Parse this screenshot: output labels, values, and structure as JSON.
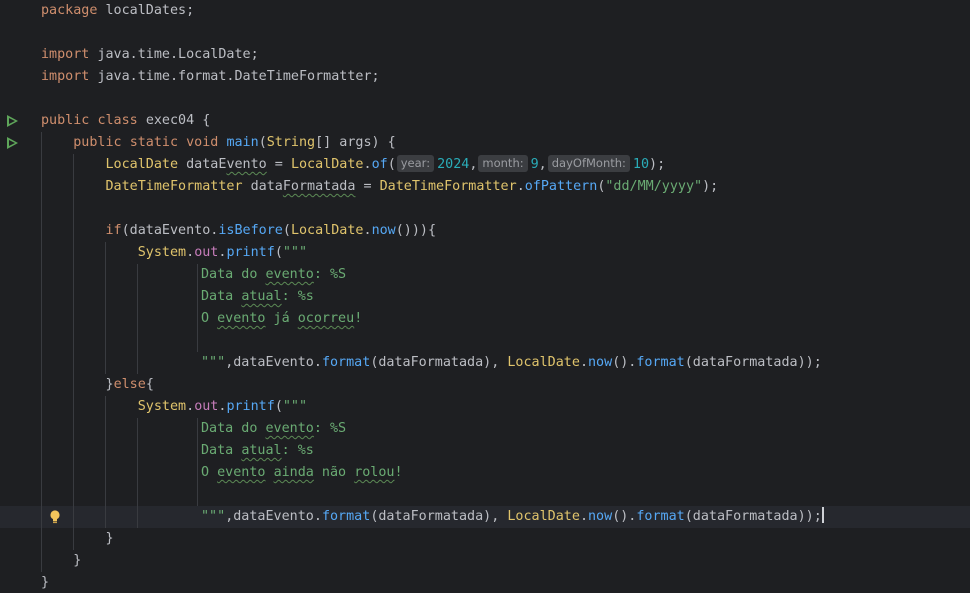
{
  "editor": {
    "language": "Java",
    "colors": {
      "background": "#1e1f22",
      "keyword": "#cf8e6d",
      "class": "#e0c46c",
      "method": "#56a8f5",
      "string": "#6aab73",
      "number": "#2aacb8",
      "field": "#c77dbb"
    },
    "gutter_icons": [
      "run-icon",
      "run-icon",
      "lightbulb-icon"
    ],
    "code": {
      "l1": {
        "kw": "package",
        "name": "localDates;"
      },
      "l3": {
        "kw": "import",
        "path": "java.time.LocalDate;"
      },
      "l4": {
        "kw": "import",
        "path": "java.time.format.DateTimeFormatter;"
      },
      "l6": {
        "kw1": "public",
        "kw2": "class",
        "name": "exec04 {"
      },
      "l7": {
        "kw1": "public",
        "kw2": "static",
        "kw3": "void",
        "method": "main",
        "p1": "(",
        "type": "String",
        "rest": "[] args) {"
      },
      "l8": {
        "type": "LocalDate",
        "var_a": "dataE",
        "var_b": "vento",
        "eq": " = ",
        "cls": "LocalDate",
        "dot": ".",
        "method": "of",
        "open": "(",
        "hint_year": "year:",
        "year": "2024",
        "c1": ",",
        "hint_month": "month:",
        "month": "9",
        "c2": ",",
        "hint_day": "dayOfMonth:",
        "day": "10",
        "close": ");"
      },
      "l9": {
        "type": "DateTimeFormatter",
        "var_a": "data",
        "var_b": "Formatada",
        "eq": " = ",
        "cls": "DateTimeFormatter",
        "dot": ".",
        "method": "ofPattern",
        "open": "(",
        "pattern": "\"dd/MM/yyyy\"",
        "close": ");"
      },
      "l11": {
        "kw": "if",
        "p1": "(dataEvento.",
        "method": "isBefore",
        "p2": "(",
        "cls": "LocalDate",
        "dot": ".",
        "method2": "now",
        "close": "())){"
      },
      "l12": {
        "cls": "System",
        "dot1": ".",
        "field": "out",
        "dot2": ".",
        "method": "printf",
        "open": "(",
        "str": "\"\"\""
      },
      "l13": {
        "a": "Data do ",
        "b": "evento",
        "c": ": %S"
      },
      "l14": {
        "a": "Data ",
        "b": "atual",
        "c": ": %s"
      },
      "l15": {
        "a": "O ",
        "b": "evento",
        "c": " já ",
        "d": "ocorreu",
        "e": "!"
      },
      "l17": {
        "str": "\"\"\"",
        "p1": ",dataEvento.",
        "m1": "format",
        "p2": "(dataFormatada), ",
        "cls": "LocalDate",
        "dot": ".",
        "m2": "now",
        "p3": "().",
        "m3": "format",
        "close": "(dataFormatada));"
      },
      "l18": {
        "p1": "}",
        "kw": "else",
        "p2": "{"
      },
      "l19": {
        "cls": "System",
        "dot1": ".",
        "field": "out",
        "dot2": ".",
        "method": "printf",
        "open": "(",
        "str": "\"\"\""
      },
      "l20": {
        "a": "Data do ",
        "b": "evento",
        "c": ": %S"
      },
      "l21": {
        "a": "Data ",
        "b": "atual",
        "c": ": %s"
      },
      "l22": {
        "a": "O ",
        "b": "evento",
        "c": " ",
        "d": "ainda",
        "e": " não ",
        "f": "rolou",
        "g": "!"
      },
      "l24": {
        "str": "\"\"\"",
        "p1": ",dataEvento.",
        "m1": "format",
        "p2": "(dataFormatada), ",
        "cls": "LocalDate",
        "dot": ".",
        "m2": "now",
        "p3": "().",
        "m3": "format",
        "close": "(dataFormatada));"
      },
      "l25": {
        "brace": "}"
      },
      "l26": {
        "brace": "}"
      },
      "l27": {
        "brace": "}"
      }
    }
  }
}
